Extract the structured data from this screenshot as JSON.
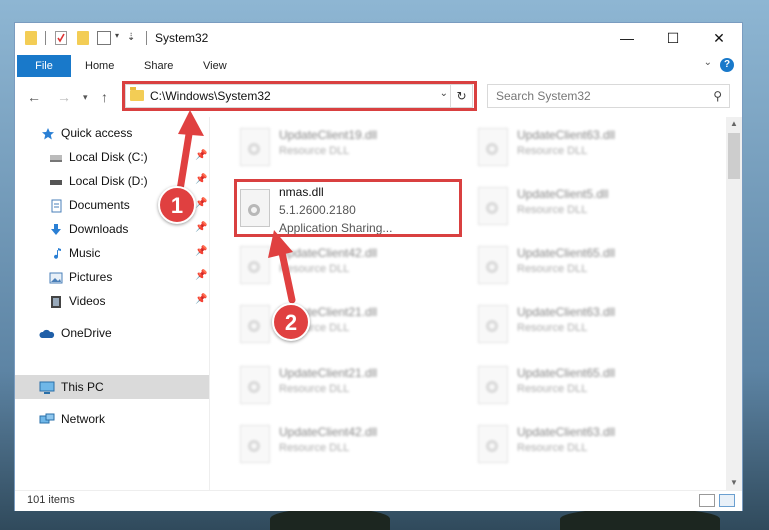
{
  "window": {
    "title": "System32",
    "controls": {
      "minimize": "—",
      "maximize": "☐",
      "close": "✕"
    }
  },
  "ribbon": {
    "tabs": [
      "File",
      "Home",
      "Share",
      "View"
    ],
    "help": "?"
  },
  "nav": {
    "address": "C:\\Windows\\System32",
    "search_placeholder": "Search System32"
  },
  "sidebar": {
    "items": [
      {
        "label": "Quick access",
        "icon": "star-icon"
      },
      {
        "label": "Local Disk (C:)",
        "icon": "drive-icon",
        "pinned": true
      },
      {
        "label": "Local Disk (D:)",
        "icon": "drive-icon",
        "pinned": true
      },
      {
        "label": "Documents",
        "icon": "documents-icon",
        "pinned": true
      },
      {
        "label": "Downloads",
        "icon": "download-icon",
        "pinned": true
      },
      {
        "label": "Music",
        "icon": "music-icon",
        "pinned": true
      },
      {
        "label": "Pictures",
        "icon": "pictures-icon",
        "pinned": true
      },
      {
        "label": "Videos",
        "icon": "videos-icon",
        "pinned": true
      },
      {
        "label": "OneDrive",
        "icon": "cloud-icon"
      },
      {
        "label": "This PC",
        "icon": "computer-icon",
        "selected": true
      },
      {
        "label": "Network",
        "icon": "network-icon"
      }
    ]
  },
  "files": {
    "left": [
      {
        "name": "UpdateClient19.dll",
        "type": "Resource DLL"
      },
      {
        "name": "nmas.dll",
        "version": "5.1.2600.2180",
        "desc": "Application Sharing..."
      },
      {
        "name": "UpdateClient42.dll",
        "type": "Resource DLL"
      },
      {
        "name": "UpdateClient21.dll",
        "type": "Resource DLL"
      },
      {
        "name": "UpdateClient21.dll",
        "type": "Resource DLL"
      },
      {
        "name": "UpdateClient42.dll",
        "type": "Resource DLL"
      }
    ],
    "right": [
      {
        "name": "UpdateClient63.dll",
        "type": "Resource DLL"
      },
      {
        "name": "UpdateClient5.dll",
        "type": "Resource DLL"
      },
      {
        "name": "UpdateClient65.dll",
        "type": "Resource DLL"
      },
      {
        "name": "UpdateClient63.dll",
        "type": "Resource DLL"
      },
      {
        "name": "UpdateClient65.dll",
        "type": "Resource DLL"
      },
      {
        "name": "UpdateClient63.dll",
        "type": "Resource DLL"
      }
    ]
  },
  "status": {
    "items_count": "101 items"
  },
  "callouts": [
    "1",
    "2"
  ],
  "colors": {
    "accent": "#1979ca",
    "highlight": "#d94040",
    "folder": "#f3cd55"
  }
}
